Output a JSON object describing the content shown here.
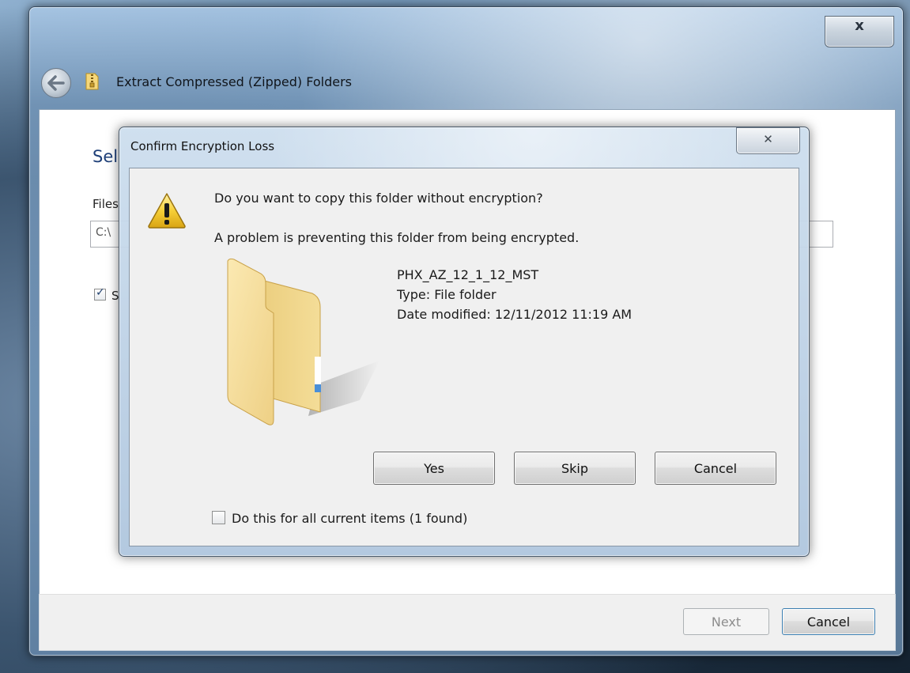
{
  "outer_window": {
    "title": "Extract Compressed (Zipped) Folders",
    "close_glyph": "x",
    "heading": "Sel",
    "files_label": "Files",
    "path_value": "C:\\",
    "show_label": "S",
    "footer": {
      "next_label": "Next",
      "cancel_label": "Cancel"
    },
    "icons": {
      "back": "back-arrow-icon",
      "app": "zip-folder-icon"
    }
  },
  "dialog": {
    "title": "Confirm Encryption Loss",
    "close_glyph": "✕",
    "question": "Do you want to copy this folder without encryption?",
    "problem": "A problem is preventing this folder from being encrypted.",
    "file": {
      "name": "PHX_AZ_12_1_12_MST",
      "type": "Type: File folder",
      "date_modified": "Date modified: 12/11/2012 11:19 AM"
    },
    "buttons": {
      "yes": "Yes",
      "skip": "Skip",
      "cancel": "Cancel"
    },
    "apply_all_label": "Do this for all current items (1 found)",
    "apply_all_checked": false,
    "icons": {
      "warning": "warning-icon",
      "folder": "folder-icon"
    }
  },
  "colors": {
    "heading_blue": "#1e3f78",
    "warning_yellow": "#f3c32a"
  }
}
